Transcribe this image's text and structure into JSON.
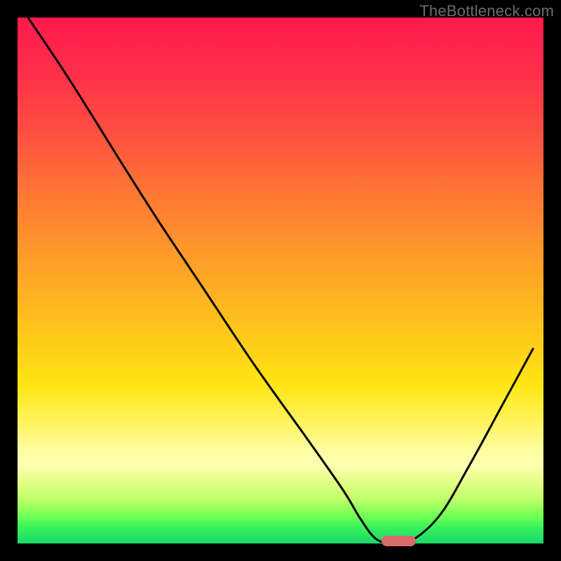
{
  "watermark": "TheBottleneck.com",
  "chart_data": {
    "type": "line",
    "title": "",
    "xlabel": "",
    "ylabel": "",
    "xlim": [
      0,
      100
    ],
    "ylim": [
      0,
      100
    ],
    "background": "gradient-red-orange-yellow-green",
    "series": [
      {
        "name": "curve",
        "color": "#000000",
        "x": [
          2,
          10,
          20,
          27,
          35,
          45,
          55,
          62,
          65,
          68,
          71,
          74,
          80,
          86,
          92,
          98
        ],
        "y": [
          100,
          88,
          72,
          61,
          49,
          34,
          20,
          10,
          5,
          1,
          0,
          0,
          5,
          15,
          26,
          37
        ]
      }
    ],
    "marker": {
      "name": "optimal-point",
      "color": "#d86a6a",
      "x": 72.5,
      "y": 0.5,
      "width_pct": 6.5,
      "height_pct": 2.0,
      "shape": "pill"
    }
  },
  "colors": {
    "black": "#000000",
    "marker": "#d86a6a",
    "watermark": "#6b6b6b"
  }
}
